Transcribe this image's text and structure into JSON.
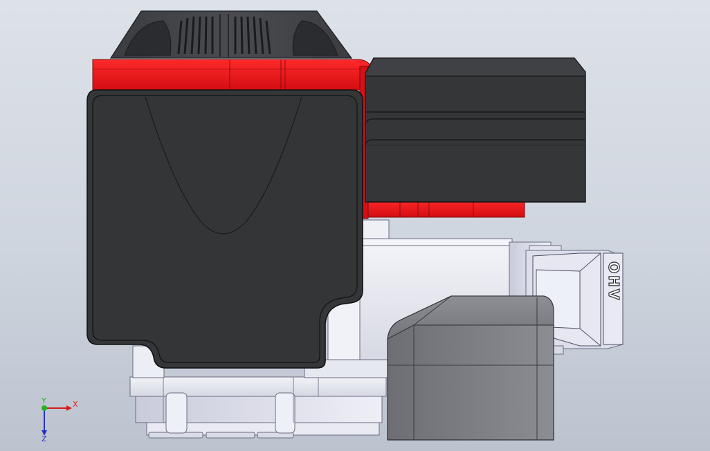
{
  "view": {
    "colors": {
      "background_top": "#dde2e9",
      "background_bottom": "#bcc3cf",
      "body_dark": "#353638",
      "accent_red": "#e8111a",
      "metal_light": "#e4e6ee",
      "edge": "#1c1c1e"
    }
  },
  "engine": {
    "badge_text": "OHV"
  },
  "triad": {
    "x_label": "X",
    "y_label": "Y",
    "z_label": "Z",
    "x_color": "#d41c1c",
    "y_color": "#25b025",
    "z_color": "#2432c8"
  }
}
